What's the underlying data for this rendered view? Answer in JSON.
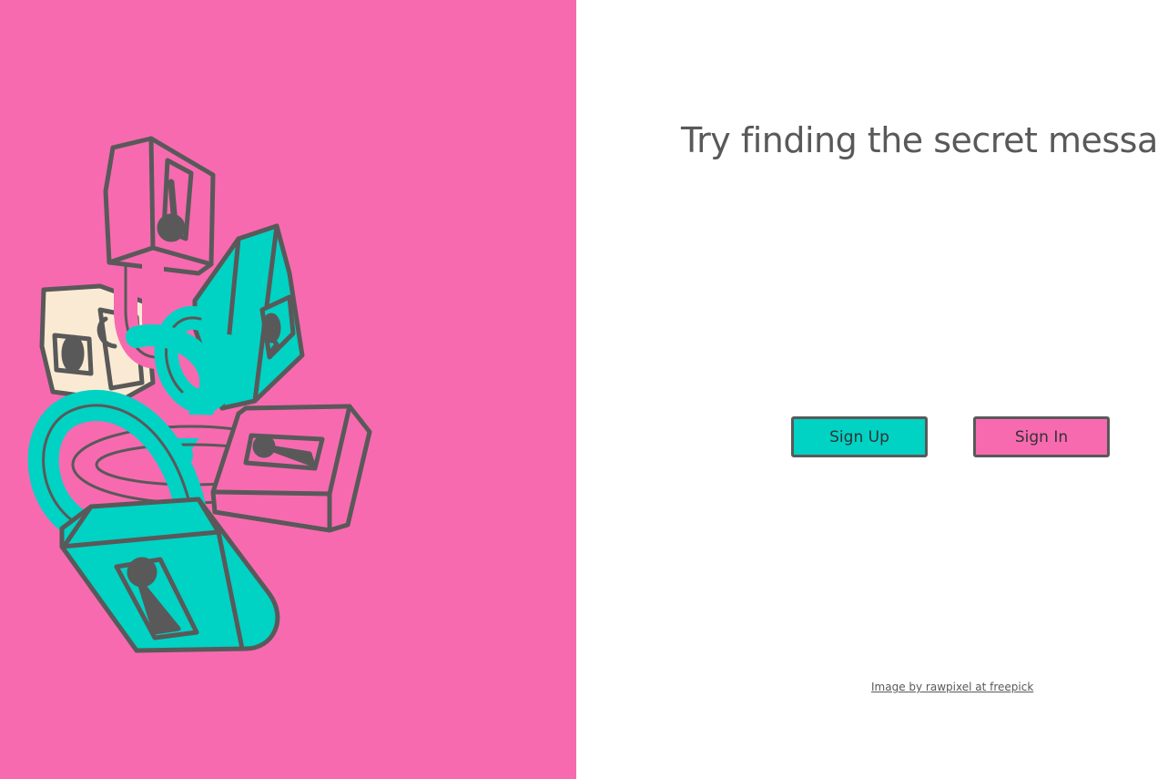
{
  "left_panel": {
    "background_color": "#f76ab0",
    "illustration": "padlocks-chain-illustration",
    "illustration_colors": {
      "pink": "#f76ab0",
      "teal": "#00d2c4",
      "cream": "#fbead3",
      "outline": "#595959"
    }
  },
  "right_panel": {
    "headline": "Try finding the secret messa",
    "buttons": {
      "sign_up_label": "Sign Up",
      "sign_in_label": "Sign In",
      "sign_up_color": "#00d2c4",
      "sign_in_color": "#f76ab0"
    },
    "credit_link": "Image by rawpixel at freepick"
  }
}
